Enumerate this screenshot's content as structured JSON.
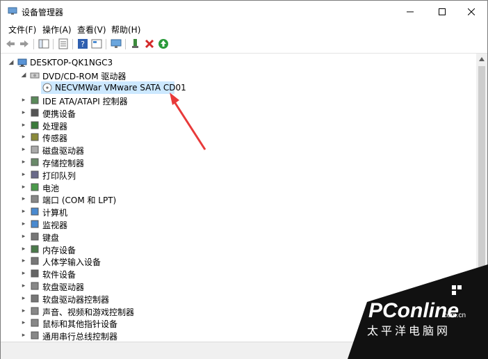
{
  "window": {
    "title": "设备管理器"
  },
  "menu": {
    "items": [
      "文件(F)",
      "操作(A)",
      "查看(V)",
      "帮助(H)"
    ]
  },
  "tree": {
    "root": "DESKTOP-QK1NGC3",
    "dvd": "DVD/CD-ROM 驱动器",
    "dvd_child": "NECVMWar VMware SATA CD01",
    "items": [
      "IDE ATA/ATAPI 控制器",
      "便携设备",
      "处理器",
      "传感器",
      "磁盘驱动器",
      "存储控制器",
      "打印队列",
      "电池",
      "端口 (COM 和 LPT)",
      "计算机",
      "监视器",
      "键盘",
      "内存设备",
      "人体学输入设备",
      "软件设备",
      "软盘驱动器",
      "软盘驱动器控制器",
      "声音、视频和游戏控制器",
      "鼠标和其他指针设备",
      "通用串行总线控制器"
    ]
  },
  "watermark": {
    "brand": "PConline",
    "domain": ".com.cn",
    "sub": "太平洋电脑网"
  },
  "colors": {
    "selection": "#cce8ff",
    "arrow": "#e83a3a"
  }
}
